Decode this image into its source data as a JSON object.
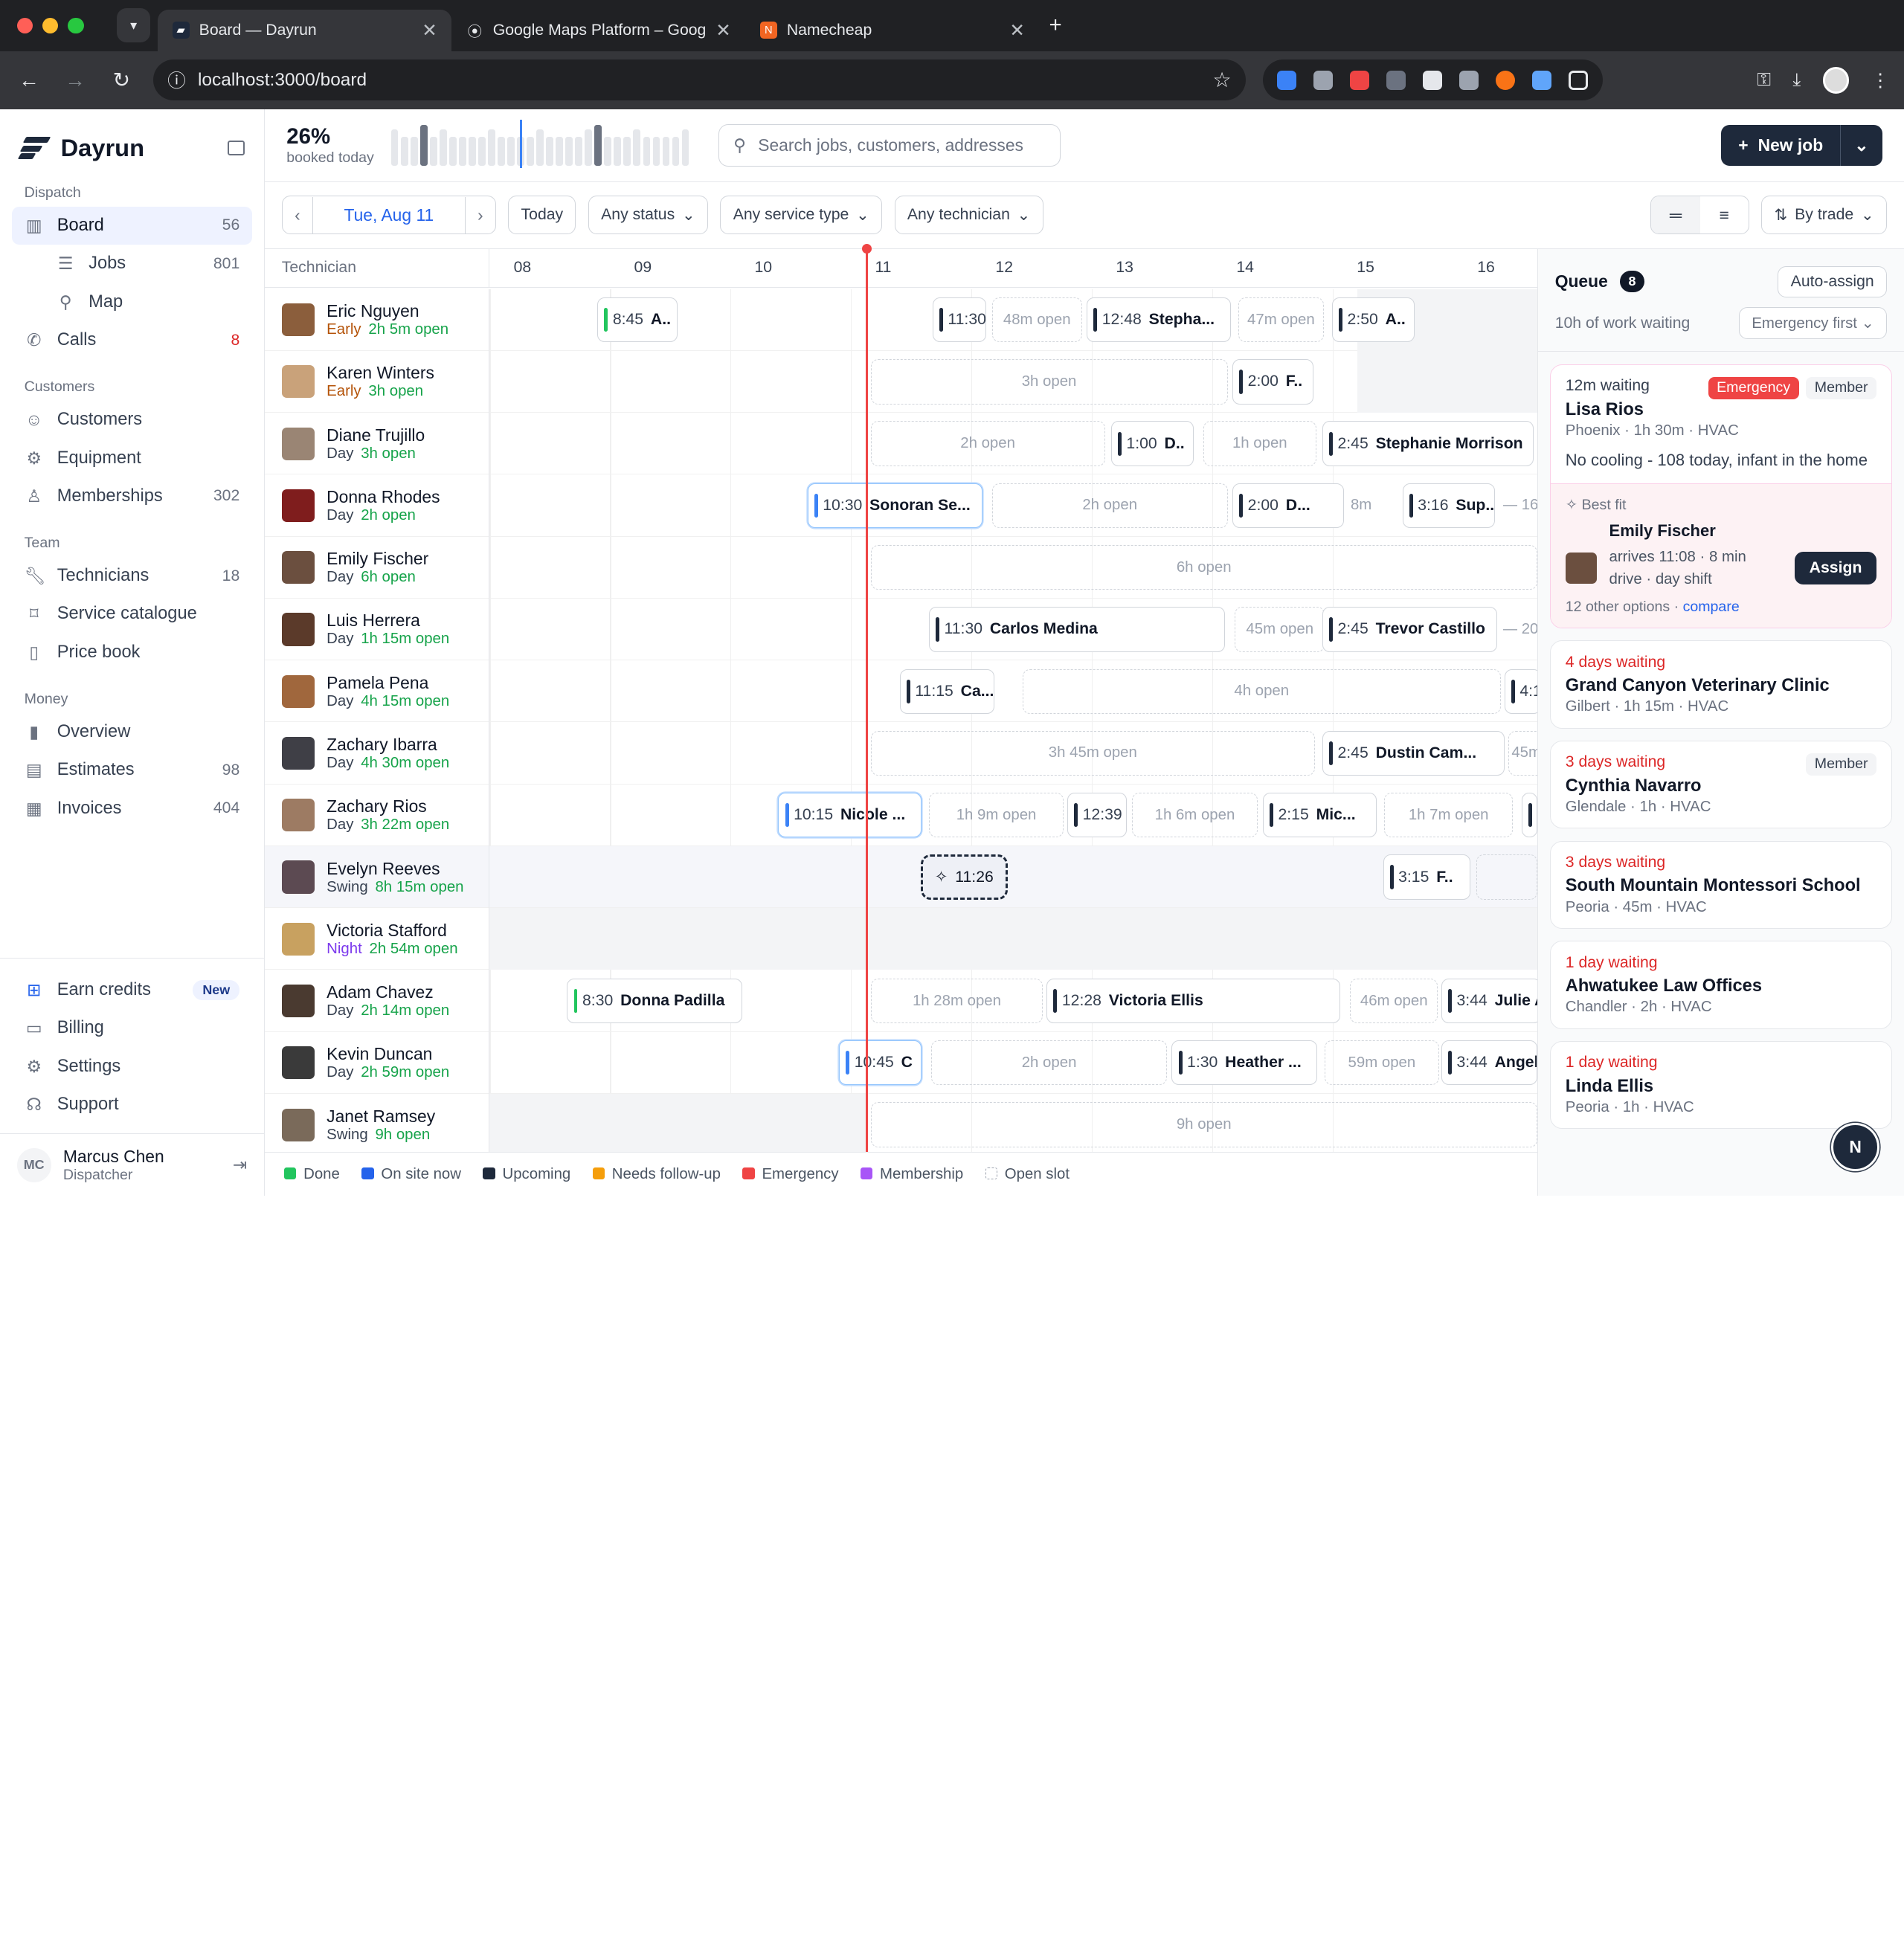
{
  "browser": {
    "tabs": [
      {
        "title": "Board — Dayrun",
        "active": true
      },
      {
        "title": "Google Maps Platform – Goog",
        "active": false
      },
      {
        "title": "Namecheap",
        "active": false
      }
    ],
    "url": "localhost:3000/board"
  },
  "sidebar": {
    "brand": "Dayrun",
    "sections": {
      "dispatch": "Dispatch",
      "customers": "Customers",
      "team": "Team",
      "money": "Money"
    },
    "board": {
      "label": "Board",
      "count": "56"
    },
    "jobs": {
      "label": "Jobs",
      "count": "801"
    },
    "map": {
      "label": "Map"
    },
    "calls": {
      "label": "Calls",
      "count": "8"
    },
    "customers": {
      "label": "Customers"
    },
    "equipment": {
      "label": "Equipment"
    },
    "memberships": {
      "label": "Memberships",
      "count": "302"
    },
    "technicians": {
      "label": "Technicians",
      "count": "18"
    },
    "service_catalogue": {
      "label": "Service catalogue"
    },
    "price_book": {
      "label": "Price book"
    },
    "overview": {
      "label": "Overview"
    },
    "estimates": {
      "label": "Estimates",
      "count": "98"
    },
    "invoices": {
      "label": "Invoices",
      "count": "404"
    },
    "earn_credits": {
      "label": "Earn credits",
      "badge": "New"
    },
    "billing": {
      "label": "Billing"
    },
    "settings": {
      "label": "Settings"
    },
    "support": {
      "label": "Support"
    },
    "user": {
      "initials": "MC",
      "name": "Marcus Chen",
      "role": "Dispatcher"
    }
  },
  "topbar": {
    "booked_value": "26%",
    "booked_label": "booked today",
    "search_placeholder": "Search jobs, customers, addresses",
    "new_job": "New job"
  },
  "filters": {
    "date": "Tue, Aug 11",
    "today": "Today",
    "status": "Any status",
    "service": "Any service type",
    "technician": "Any technician",
    "group": "By trade"
  },
  "board": {
    "tech_header": "Technician",
    "hours": [
      "08",
      "09",
      "10",
      "11",
      "12",
      "13",
      "14",
      "15",
      "16"
    ],
    "now_label": "11:26"
  },
  "technicians": [
    {
      "name": "Eric Nguyen",
      "shift": "Early",
      "open": "2h 5m open",
      "av": "#8b5e3c"
    },
    {
      "name": "Karen Winters",
      "shift": "Early",
      "open": "3h open",
      "av": "#c9a27a"
    },
    {
      "name": "Diane Trujillo",
      "shift": "Day",
      "open": "3h open",
      "av": "#9a8574"
    },
    {
      "name": "Donna Rhodes",
      "shift": "Day",
      "open": "2h open",
      "av": "#7f1d1d"
    },
    {
      "name": "Emily Fischer",
      "shift": "Day",
      "open": "6h open",
      "av": "#6b4f3f"
    },
    {
      "name": "Luis Herrera",
      "shift": "Day",
      "open": "1h 15m open",
      "av": "#5b3a2a"
    },
    {
      "name": "Pamela Pena",
      "shift": "Day",
      "open": "4h 15m open",
      "av": "#a0673d"
    },
    {
      "name": "Zachary Ibarra",
      "shift": "Day",
      "open": "4h 30m open",
      "av": "#3f3f46"
    },
    {
      "name": "Zachary Rios",
      "shift": "Day",
      "open": "3h 22m open",
      "av": "#9d7b63"
    },
    {
      "name": "Evelyn Reeves",
      "shift": "Swing",
      "open": "8h 15m open",
      "av": "#5c4a52"
    },
    {
      "name": "Victoria Stafford",
      "shift": "Night",
      "open": "2h 54m open",
      "av": "#c8a160"
    },
    {
      "name": "Adam Chavez",
      "shift": "Day",
      "open": "2h 14m open",
      "av": "#4a3a30"
    },
    {
      "name": "Kevin Duncan",
      "shift": "Day",
      "open": "2h 59m open",
      "av": "#3a3a3a"
    },
    {
      "name": "Janet Ramsey",
      "shift": "Swing",
      "open": "9h open",
      "av": "#7a6a5a"
    }
  ],
  "blocks": [
    [
      {
        "k": "j",
        "t": "8:45",
        "n": "A..",
        "c": "#22c55e"
      },
      {
        "k": "j",
        "t": "11:30",
        "n": ""
      },
      {
        "k": "o",
        "n": "48m open"
      },
      {
        "k": "j",
        "t": "12:48",
        "n": "Stepha..."
      },
      {
        "k": "o",
        "n": "47m open"
      },
      {
        "k": "j",
        "t": "2:50",
        "n": "A.."
      }
    ],
    [
      {
        "k": "o",
        "n": "3h open"
      },
      {
        "k": "j",
        "t": "2:00",
        "n": "F.."
      }
    ],
    [
      {
        "k": "o",
        "n": "2h open"
      },
      {
        "k": "j",
        "t": "1:00",
        "n": "D.."
      },
      {
        "k": "o",
        "n": "1h open"
      },
      {
        "k": "j",
        "t": "2:45",
        "n": "Stephanie Morrison"
      }
    ],
    [
      {
        "k": "j",
        "t": "10:30",
        "n": "Sonoran Se...",
        "c": "#3b82f6",
        "s": 1
      },
      {
        "k": "o",
        "n": "2h open"
      },
      {
        "k": "j",
        "t": "2:00",
        "n": "D..."
      },
      {
        "k": "x",
        "n": "8m"
      },
      {
        "k": "j",
        "t": "3:16",
        "n": "Sup..."
      },
      {
        "k": "x",
        "n": "— 16"
      }
    ],
    [
      {
        "k": "o",
        "n": "6h open"
      }
    ],
    [
      {
        "k": "j",
        "t": "11:30",
        "n": "Carlos Medina"
      },
      {
        "k": "o",
        "n": "45m open"
      },
      {
        "k": "j",
        "t": "2:45",
        "n": "Trevor Castillo"
      },
      {
        "k": "x",
        "n": "— 20"
      }
    ],
    [
      {
        "k": "j",
        "t": "11:15",
        "n": "Ca..."
      },
      {
        "k": "o",
        "n": "4h open"
      },
      {
        "k": "j",
        "t": "4:1",
        "n": ""
      }
    ],
    [
      {
        "k": "o",
        "n": "3h 45m open"
      },
      {
        "k": "j",
        "t": "2:45",
        "n": "Dustin Cam..."
      },
      {
        "k": "o",
        "n": "45m"
      }
    ],
    [
      {
        "k": "j",
        "t": "10:15",
        "n": "Nicole ...",
        "c": "#3b82f6",
        "s": 1
      },
      {
        "k": "o",
        "n": "1h 9m open"
      },
      {
        "k": "j",
        "t": "12:39",
        "n": ""
      },
      {
        "k": "o",
        "n": "1h 6m open"
      },
      {
        "k": "j",
        "t": "2:15",
        "n": "Mic..."
      },
      {
        "k": "o",
        "n": "1h 7m open"
      },
      {
        "k": "j",
        "t": "",
        "n": ""
      }
    ],
    [
      {
        "k": "g",
        "n": "11:26"
      },
      {
        "k": "j",
        "t": "3:15",
        "n": "F.."
      },
      {
        "k": "o",
        "n": ""
      }
    ],
    [],
    [
      {
        "k": "j",
        "t": "8:30",
        "n": "Donna Padilla",
        "c": "#22c55e"
      },
      {
        "k": "o",
        "n": "1h 28m open"
      },
      {
        "k": "j",
        "t": "12:28",
        "n": "Victoria Ellis"
      },
      {
        "k": "o",
        "n": "46m open"
      },
      {
        "k": "j",
        "t": "3:44",
        "n": "Julie A"
      }
    ],
    [
      {
        "k": "j",
        "t": "10:45",
        "n": "C",
        "c": "#3b82f6",
        "s": 1
      },
      {
        "k": "o",
        "n": "2h open"
      },
      {
        "k": "j",
        "t": "1:30",
        "n": "Heather ..."
      },
      {
        "k": "o",
        "n": "59m open"
      },
      {
        "k": "j",
        "t": "3:44",
        "n": "Angel"
      }
    ],
    [
      {
        "k": "o",
        "n": "9h open"
      }
    ]
  ],
  "legend": [
    "Done",
    "On site now",
    "Upcoming",
    "Needs follow-up",
    "Emergency",
    "Membership",
    "Open slot"
  ],
  "legend_colors": [
    "#22c55e",
    "#2563eb",
    "#1e293b",
    "#f59e0b",
    "#ef4444",
    "#a855f7",
    "#ffffff"
  ],
  "queue": {
    "title": "Queue",
    "count": "8",
    "auto_assign": "Auto-assign",
    "summary": "10h of work waiting",
    "sort": "Emergency first",
    "first": {
      "waiting": "12m waiting",
      "tag1": "Emergency",
      "tag2": "Member",
      "name": "Lisa Rios",
      "meta": "Phoenix · 1h 30m · HVAC",
      "desc": "No cooling - 108 today, infant in the home",
      "best_fit": "Best fit",
      "tech": "Emily Fischer",
      "detail1": "arrives 11:08 · 8 min",
      "detail2": "drive · day shift",
      "assign": "Assign",
      "options": "12 other options · ",
      "compare": "compare"
    },
    "cards": [
      {
        "waiting": "4 days waiting",
        "name": "Grand Canyon Veterinary Clinic",
        "meta": "Gilbert · 1h 15m · HVAC",
        "tag": ""
      },
      {
        "waiting": "3 days waiting",
        "name": "Cynthia Navarro",
        "meta": "Glendale · 1h · HVAC",
        "tag": "Member"
      },
      {
        "waiting": "3 days waiting",
        "name": "South Mountain Montessori School",
        "meta": "Peoria · 45m · HVAC",
        "tag": ""
      },
      {
        "waiting": "1 day waiting",
        "name": "Ahwatukee Law Offices",
        "meta": "Chandler · 2h · HVAC",
        "tag": ""
      },
      {
        "waiting": "1 day waiting",
        "name": "Linda Ellis",
        "meta": "Peoria · 1h · HVAC",
        "tag": ""
      }
    ]
  },
  "fab": "N"
}
